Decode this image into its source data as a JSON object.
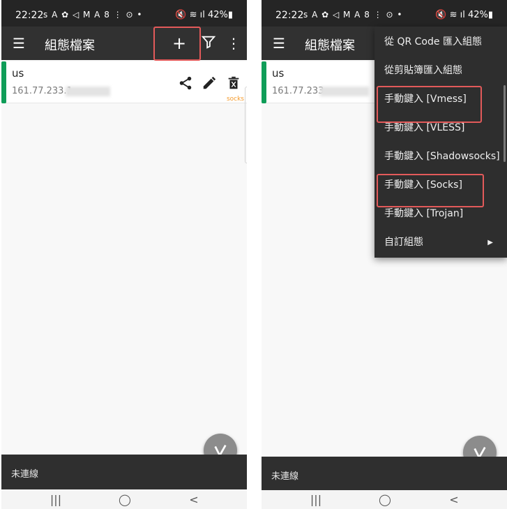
{
  "status": {
    "time": "22:22",
    "icons": "s A ✿ ◁ M A 8 ⋮ ⊙ •",
    "right": "🔇 ≋ ıl 42%▮"
  },
  "appbar": {
    "title": "組態檔案",
    "add": "+",
    "filter": "⏷",
    "more": "⋮",
    "menu": "☰"
  },
  "profile": {
    "name": "us",
    "address": "161.77.233.1",
    "type": "socks"
  },
  "profile_right": {
    "name": "us",
    "address": "161.77.233."
  },
  "bottom": {
    "status": "未連線"
  },
  "fab": {
    "icon": "v-icon"
  },
  "menu": {
    "items": [
      {
        "label": "從 QR Code 匯入組態"
      },
      {
        "label": "從剪貼簿匯入組態"
      },
      {
        "label": "手動鍵入 [Vmess]"
      },
      {
        "label": "手動鍵入 [VLESS]"
      },
      {
        "label": "手動鍵入 [Shadowsocks]"
      },
      {
        "label": "手動鍵入 [Socks]"
      },
      {
        "label": "手動鍵入 [Trojan]"
      },
      {
        "label": "自訂組態"
      }
    ],
    "submenu_arrow": "▶"
  },
  "nav": {
    "recents": "|||",
    "home": "◯",
    "back": "<"
  },
  "colors": {
    "accent": "#0f9d58",
    "highlight": "#e35a5a",
    "type": "#f59b2d"
  }
}
